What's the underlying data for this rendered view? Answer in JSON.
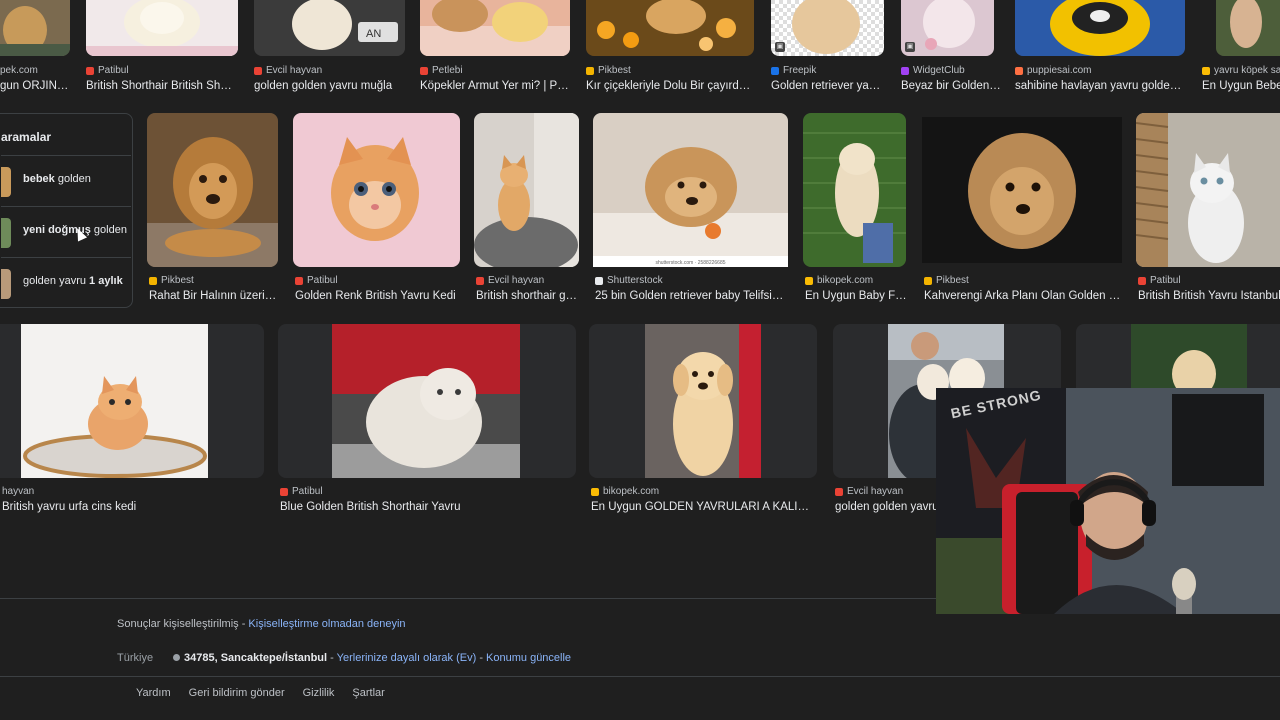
{
  "row1": [
    {
      "source": "pek.com",
      "title": "gun ORJINA...",
      "fav": "#f4b400"
    },
    {
      "source": "Patibul",
      "title": "British Shorthair British Short...",
      "fav": "#ea4335"
    },
    {
      "source": "Evcil hayvan",
      "title": "golden golden yavru muğla",
      "fav": "#ea4335"
    },
    {
      "source": "Petlebi",
      "title": "Köpekler Armut Yer mi? | Petl...",
      "fav": "#ea4335"
    },
    {
      "source": "Pikbest",
      "title": "Kır çiçekleriyle Dolu Bir çayırda K...",
      "fav": "#f4b400"
    },
    {
      "source": "Freepik",
      "title": "Golden retriever yavr...",
      "fav": "#1a73e8"
    },
    {
      "source": "WidgetClub",
      "title": "Beyaz bir Golden ...",
      "fav": "#a142f4"
    },
    {
      "source": "puppiesai.com",
      "title": "sahibine havlayan yavru golden | ...",
      "fav": "#ff7043"
    },
    {
      "source": "yavru köpek sahi",
      "title": "En Uygun Bebek",
      "fav": "#fbbc04"
    }
  ],
  "related": {
    "title": "aramalar",
    "items": [
      {
        "bold": "bebek",
        "text": " golden"
      },
      {
        "bold": "yeni doğmuş",
        "text": " golden"
      },
      {
        "bold": "",
        "text": "golden yavru ",
        "bold2": "1 aylık"
      }
    ]
  },
  "row2": [
    {
      "source": "Pikbest",
      "title": "Rahat Bir Halının üzerind...",
      "fav": "#f4b400"
    },
    {
      "source": "Patibul",
      "title": "Golden Renk British Yavru Kedi",
      "fav": "#ea4335"
    },
    {
      "source": "Evcil hayvan",
      "title": "British shorthair go...",
      "fav": "#ea4335"
    },
    {
      "source": "Shutterstock",
      "title": "25 bin Golden retriever baby Telifsiz G...",
      "fav": "#e8eaed",
      "watermark": "shutterstock.com · 2588226685"
    },
    {
      "source": "bikopek.com",
      "title": "En Uygun Baby Fa...",
      "fav": "#fbbc04"
    },
    {
      "source": "Pikbest",
      "title": "Kahverengi Arka Planı Olan Golden Ret...",
      "fav": "#f4b400"
    },
    {
      "source": "Patibul",
      "title": "British British Yavru Istanbul Bri",
      "fav": "#ea4335"
    }
  ],
  "row3": [
    {
      "source": "hayvan",
      "title": "British yavru urfa cins kedi",
      "fav": ""
    },
    {
      "source": "Patibul",
      "title": "Blue Golden British Shorthair Yavru",
      "fav": "#ea4335"
    },
    {
      "source": "bikopek.com",
      "title": "En Uygun GOLDEN YAVRULARI A KALITE - ...",
      "fav": "#fbbc04"
    },
    {
      "source": "Evcil hayvan",
      "title": "golden golden yavru m",
      "fav": "#ea4335"
    }
  ],
  "footer": {
    "personalized": "Sonuçlar kişiselleştirilmiş",
    "dash": " - ",
    "try_link": "Kişiselleştirme olmadan deneyin",
    "country": "Türkiye",
    "location": "34785, Sancaktepe/İstanbul",
    "location_desc": "Yerlerinize dayalı olarak (Ev)",
    "update_link": "Konumu güncelle",
    "links": [
      "Yardım",
      "Geri bildirim gönder",
      "Gizlilik",
      "Şartlar"
    ]
  },
  "webcam": {
    "shirt_text": "BE STRONG"
  }
}
